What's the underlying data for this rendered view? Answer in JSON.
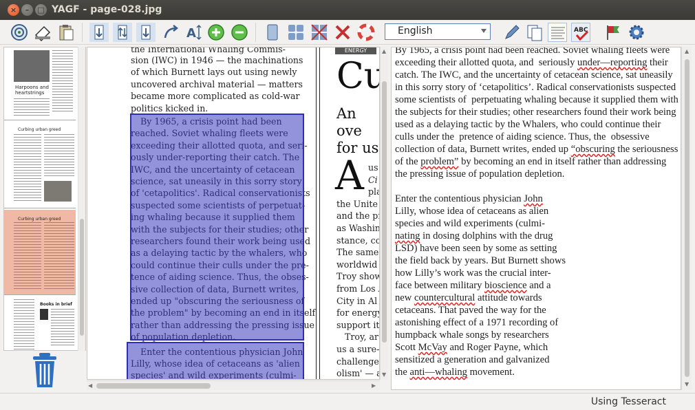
{
  "window": {
    "title": "YAGF - page-028.jpg"
  },
  "toolbar": {
    "language": "English",
    "icons": [
      "scan-icon",
      "open-image-icon",
      "paste-icon",
      "rotate-left-icon",
      "flip-icon",
      "rotate-right-icon",
      "deskew-icon",
      "text-size-icon",
      "zoom-in-icon",
      "zoom-out-icon",
      "single-block-icon",
      "blocks-icon",
      "auto-blocks-icon",
      "clear-blocks-icon",
      "help-ring-icon",
      "recognize-pencil-icon",
      "copy-text-icon",
      "recognize-all-icon",
      "spellcheck-icon",
      "flag-icon",
      "settings-gear-icon"
    ]
  },
  "image_view": {
    "left_column_lines": [
      "sion (IWC) in 1946 — the machinations",
      "of which Burnett lays out using newly",
      "uncovered archival material — matters",
      "became more complicated as cold-war",
      "politics kicked in.",
      "By 1965, a crisis point had been",
      "reached. Soviet whaling fleets were",
      "exceeding their allotted quota, and seri-",
      "ously under-reporting their catch. The",
      "IWC, and the uncertainty of cetacean",
      "science, sat uneasily in this sorry story",
      "of 'cetapolitics'. Radical conservationists",
      "suspected some scientists of perpetuat-",
      "ing whaling because it supplied them",
      "with the subjects for their studies; other",
      "researchers found their work being used",
      "as a delaying tactic by the whalers, who",
      "could continue their culls under the pre-",
      "tence of aiding science. Thus, the obses-",
      "sive collection of data, Burnett writes,",
      "ended up \"obscuring the seriousness of",
      "the problem\" by becoming an end in itself",
      "rather than addressing the pressing issue",
      "of population depletion.",
      "Enter the contentious physician John",
      "Lilly, whose idea of cetaceans as 'alien",
      "species' and wild experiments (culmi-"
    ],
    "right_column_heading": "Cu",
    "right_column_sub": [
      "An ove",
      "for us"
    ],
    "right_column_lines": [
      "us",
      "Ci",
      "pla",
      "the Unite",
      "and the pr",
      "as Washing",
      "stance, com",
      "The same",
      "worldwid",
      "Troy show",
      "from Los A",
      "City in Al",
      "for energy",
      "support it.",
      "Troy, ar",
      "us a sure-h",
      "challenges",
      "olism' — a"
    ],
    "drop_cap": "A",
    "top_line": "the International Whaling Commis-"
  },
  "editor": {
    "paragraphs": [
      "By 1965, a crisis point had been reached. Soviet whaling fleets were exceeding their allotted quota, and  seriously under—reporting their catch. The IWC, and the uncertainty of cetacean science, sat uneasily in this sorry story of ‘cetapolitics’. Radical conservationists suspected some scientists of  perpetuating whaling because it supplied them with the subjects for their studies; other researchers found their work being used as a delaying tactic by the Whalers, who could continue their culls under the  pretence of aiding science. Thus, the  obsessive collection of data, Burnett writes, ended up “obscuring the seriousness of the problem” by becoming an end in itself rather than addressing the pressing issue of population depletion.",
      "Enter the contentious physician John\nLilly, whose idea of cetaceans as alien\nspecies and wild experiments (culmi-\nnating in dosing dolphins with the drug\nLSD) have been seen by some as setting\nthe field back by years. But Burnett shows\nhow Lilly’s work was the crucial inter-\nface between military bioscience and a\nnew countercultural attitude towards\ncetaceans. That paved the way for the\nastonishing effect of a 1971 recording of\nhumpback whale songs by researchers\nScott McVay and Roger Payne, which\nsensitized a generation and galvanized\nthe anti—whaling movement."
    ],
    "misspelled": [
      "under—reporting",
      "“obscuring",
      "problem”",
      "John",
      "nating",
      "bioscience",
      "countercultural",
      "McVay",
      "anti—whaling"
    ]
  },
  "status": {
    "engine": "Using Tesseract"
  },
  "colors": {
    "selection": "#3a3abe",
    "selected_thumb": "#f0b9a6",
    "accent": "#5c7fb3"
  }
}
